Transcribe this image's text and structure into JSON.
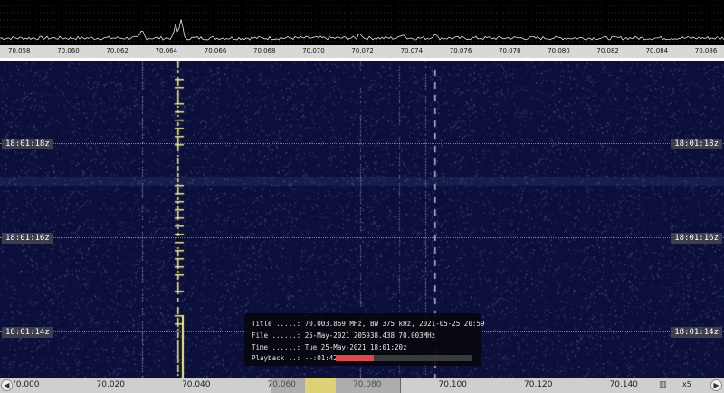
{
  "colors": {
    "waterfall_bg": "#0b0f3a",
    "signal": "#f2f07a",
    "playback_fill": "#e04848",
    "scale_bg": "#d8d8d8"
  },
  "spectrum": {
    "frequency_ticks": [
      "70.058",
      "70.060",
      "70.062",
      "70.064",
      "70.066",
      "70.068",
      "70.070",
      "70.072",
      "70.074",
      "70.076",
      "70.078",
      "70.080",
      "70.082",
      "70.084",
      "70.086"
    ]
  },
  "waterfall": {
    "time_marks": [
      "18:01:18z",
      "18:01:16z",
      "18:01:14z"
    ]
  },
  "info": {
    "title_row": "Title .....: 70.003.869 MHz, BW 375 kHz, 2021-05-25 20:59",
    "file_row": "File ......: 25-May-2021 205938.438 70.003MHz",
    "time_row": "Time ......: Tue 25-May-2021 18:01:20z",
    "playback_row": "Playback ..: --:01:42",
    "playback_progress": 0.28
  },
  "bottom": {
    "frequency_ticks": [
      "70.000",
      "70.020",
      "70.040",
      "70.060",
      "70.080",
      "70.100",
      "70.120",
      "70.140"
    ],
    "left_button": "◀",
    "right_button": "▶",
    "zoom_icon": "waterfall-icon",
    "zoom_label": "x5"
  }
}
